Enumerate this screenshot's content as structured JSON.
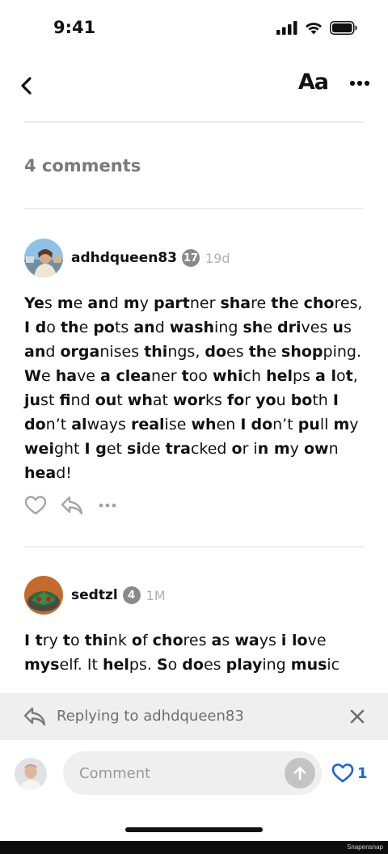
{
  "status_bar": {
    "time": "9:41"
  },
  "nav": {
    "font_size_label": "Aa"
  },
  "comments_header": {
    "count_label": "4 comments"
  },
  "comments": [
    {
      "username": "adhdqueen83",
      "level": "17",
      "time": "19d",
      "segments": [
        {
          "b": true,
          "t": "Ye"
        },
        {
          "b": false,
          "t": "s "
        },
        {
          "b": true,
          "t": "m"
        },
        {
          "b": false,
          "t": "e "
        },
        {
          "b": true,
          "t": "an"
        },
        {
          "b": false,
          "t": "d "
        },
        {
          "b": true,
          "t": "m"
        },
        {
          "b": false,
          "t": "y "
        },
        {
          "b": true,
          "t": "part"
        },
        {
          "b": false,
          "t": "ner "
        },
        {
          "b": true,
          "t": "sha"
        },
        {
          "b": false,
          "t": "re "
        },
        {
          "b": true,
          "t": "th"
        },
        {
          "b": false,
          "t": "e "
        },
        {
          "b": true,
          "t": "cho"
        },
        {
          "b": false,
          "t": "res, "
        },
        {
          "b": true,
          "t": "I d"
        },
        {
          "b": false,
          "t": "o "
        },
        {
          "b": true,
          "t": "th"
        },
        {
          "b": false,
          "t": "e "
        },
        {
          "b": true,
          "t": "po"
        },
        {
          "b": false,
          "t": "ts "
        },
        {
          "b": true,
          "t": "an"
        },
        {
          "b": false,
          "t": "d "
        },
        {
          "b": true,
          "t": "wash"
        },
        {
          "b": false,
          "t": "ing "
        },
        {
          "b": true,
          "t": "sh"
        },
        {
          "b": false,
          "t": "e "
        },
        {
          "b": true,
          "t": "dri"
        },
        {
          "b": false,
          "t": "ves "
        },
        {
          "b": true,
          "t": "u"
        },
        {
          "b": false,
          "t": "s "
        },
        {
          "b": true,
          "t": "an"
        },
        {
          "b": false,
          "t": "d "
        },
        {
          "b": true,
          "t": "orga"
        },
        {
          "b": false,
          "t": "nises "
        },
        {
          "b": true,
          "t": "thi"
        },
        {
          "b": false,
          "t": "ngs, "
        },
        {
          "b": true,
          "t": "do"
        },
        {
          "b": false,
          "t": "es "
        },
        {
          "b": true,
          "t": "th"
        },
        {
          "b": false,
          "t": "e "
        },
        {
          "b": true,
          "t": "shop"
        },
        {
          "b": false,
          "t": "ping. "
        },
        {
          "b": true,
          "t": "W"
        },
        {
          "b": false,
          "t": "e "
        },
        {
          "b": true,
          "t": "ha"
        },
        {
          "b": false,
          "t": "ve "
        },
        {
          "b": true,
          "t": "a "
        },
        {
          "b": true,
          "t": "clea"
        },
        {
          "b": false,
          "t": "ner "
        },
        {
          "b": true,
          "t": "t"
        },
        {
          "b": false,
          "t": "oo "
        },
        {
          "b": true,
          "t": "whi"
        },
        {
          "b": false,
          "t": "ch "
        },
        {
          "b": true,
          "t": "hel"
        },
        {
          "b": false,
          "t": "ps "
        },
        {
          "b": true,
          "t": "a l"
        },
        {
          "b": false,
          "t": "o"
        },
        {
          "b": true,
          "t": "t"
        },
        {
          "b": false,
          "t": ", "
        },
        {
          "b": true,
          "t": "ju"
        },
        {
          "b": false,
          "t": "st "
        },
        {
          "b": true,
          "t": "fi"
        },
        {
          "b": false,
          "t": "nd "
        },
        {
          "b": true,
          "t": "ou"
        },
        {
          "b": false,
          "t": "t "
        },
        {
          "b": true,
          "t": "wh"
        },
        {
          "b": false,
          "t": "at "
        },
        {
          "b": true,
          "t": "wor"
        },
        {
          "b": false,
          "t": "ks "
        },
        {
          "b": true,
          "t": "fo"
        },
        {
          "b": false,
          "t": "r "
        },
        {
          "b": true,
          "t": "yo"
        },
        {
          "b": false,
          "t": "u "
        },
        {
          "b": true,
          "t": "bo"
        },
        {
          "b": false,
          "t": "th "
        },
        {
          "b": true,
          "t": "I do"
        },
        {
          "b": false,
          "t": "n’t "
        },
        {
          "b": true,
          "t": "al"
        },
        {
          "b": false,
          "t": "ways "
        },
        {
          "b": true,
          "t": "real"
        },
        {
          "b": false,
          "t": "ise "
        },
        {
          "b": true,
          "t": "wh"
        },
        {
          "b": false,
          "t": "en "
        },
        {
          "b": true,
          "t": "I"
        },
        {
          "b": false,
          "t": " "
        },
        {
          "b": true,
          "t": "do"
        },
        {
          "b": false,
          "t": "n’t "
        },
        {
          "b": true,
          "t": "pu"
        },
        {
          "b": false,
          "t": "ll "
        },
        {
          "b": true,
          "t": "m"
        },
        {
          "b": false,
          "t": "y "
        },
        {
          "b": true,
          "t": "wei"
        },
        {
          "b": false,
          "t": "ght "
        },
        {
          "b": true,
          "t": "I g"
        },
        {
          "b": false,
          "t": "et "
        },
        {
          "b": true,
          "t": "si"
        },
        {
          "b": false,
          "t": "de "
        },
        {
          "b": true,
          "t": "tra"
        },
        {
          "b": false,
          "t": "cked "
        },
        {
          "b": true,
          "t": "o"
        },
        {
          "b": false,
          "t": "r "
        },
        {
          "b": false,
          "t": "i"
        },
        {
          "b": true,
          "t": "n m"
        },
        {
          "b": false,
          "t": "y "
        },
        {
          "b": true,
          "t": "ow"
        },
        {
          "b": false,
          "t": "n "
        },
        {
          "b": true,
          "t": "hea"
        },
        {
          "b": false,
          "t": "d!"
        }
      ]
    },
    {
      "username": "sedtzl",
      "level": "4",
      "time": "1M",
      "segments": [
        {
          "b": true,
          "t": "I t"
        },
        {
          "b": false,
          "t": "ry "
        },
        {
          "b": true,
          "t": "t"
        },
        {
          "b": false,
          "t": "o "
        },
        {
          "b": true,
          "t": "thi"
        },
        {
          "b": false,
          "t": "nk "
        },
        {
          "b": true,
          "t": "o"
        },
        {
          "b": false,
          "t": "f "
        },
        {
          "b": true,
          "t": "cho"
        },
        {
          "b": false,
          "t": "res "
        },
        {
          "b": true,
          "t": "a"
        },
        {
          "b": false,
          "t": "s "
        },
        {
          "b": true,
          "t": "wa"
        },
        {
          "b": false,
          "t": "ys "
        },
        {
          "b": true,
          "t": "i lo"
        },
        {
          "b": false,
          "t": "ve "
        },
        {
          "b": true,
          "t": "mys"
        },
        {
          "b": false,
          "t": "elf. It "
        },
        {
          "b": true,
          "t": "hel"
        },
        {
          "b": false,
          "t": "ps. "
        },
        {
          "b": true,
          "t": "S"
        },
        {
          "b": false,
          "t": "o "
        },
        {
          "b": true,
          "t": "do"
        },
        {
          "b": false,
          "t": "es "
        },
        {
          "b": true,
          "t": "play"
        },
        {
          "b": false,
          "t": "ing "
        },
        {
          "b": true,
          "t": "mus"
        },
        {
          "b": false,
          "t": "ic"
        }
      ]
    }
  ],
  "reply_bar": {
    "text": "Replying to adhdqueen83"
  },
  "compose": {
    "placeholder": "Comment",
    "like_count": "1"
  },
  "colors": {
    "accent": "#1c64d8",
    "badge": "#8a8a8a",
    "muted": "#7a7a7a"
  },
  "icons": [
    "back-icon",
    "more-icon",
    "heart-icon",
    "reply-icon",
    "close-icon",
    "send-arrow-icon",
    "signal-icon",
    "wifi-icon",
    "battery-icon"
  ],
  "watermark": "Snapensnap"
}
